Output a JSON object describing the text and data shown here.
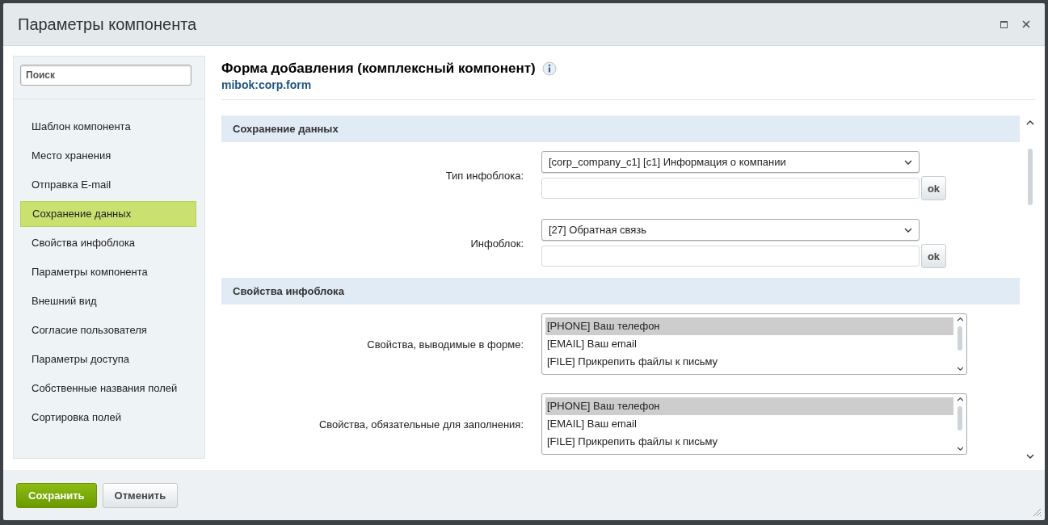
{
  "window": {
    "title": "Параметры компонента"
  },
  "sidebar": {
    "search": {
      "placeholder": "Поиск"
    },
    "items": [
      {
        "label": "Шаблон компонента",
        "selected": false
      },
      {
        "label": "Место хранения",
        "selected": false
      },
      {
        "label": "Отправка E-mail",
        "selected": false
      },
      {
        "label": "Сохранение данных",
        "selected": true
      },
      {
        "label": "Свойства инфоблока",
        "selected": false
      },
      {
        "label": "Параметры компонента",
        "selected": false
      },
      {
        "label": "Внешний вид",
        "selected": false
      },
      {
        "label": "Согласие пользователя",
        "selected": false
      },
      {
        "label": "Параметры доступа",
        "selected": false
      },
      {
        "label": "Собственные названия полей",
        "selected": false
      },
      {
        "label": "Сортировка полей",
        "selected": false
      }
    ]
  },
  "header": {
    "title": "Форма добавления (комплексный компонент)",
    "subtitle": "mibok:corp.form"
  },
  "sections": [
    {
      "title": "Сохранение данных",
      "fields": [
        {
          "kind": "select-with-input",
          "label": "Тип инфоблока:",
          "value": "[corp_company_c1] [c1] Информация о компании",
          "button": "ok"
        },
        {
          "kind": "select-with-input",
          "label": "Инфоблок:",
          "value": "[27] Обратная связь",
          "button": "ok"
        }
      ]
    },
    {
      "title": "Свойства инфоблока",
      "fields": [
        {
          "kind": "listbox",
          "label": "Свойства, выводимые в форме:",
          "options": [
            {
              "label": "[PHONE] Ваш телефон",
              "selected": true
            },
            {
              "label": "[EMAIL] Ваш email",
              "selected": false
            },
            {
              "label": "[FILE] Прикрепить файлы к письму",
              "selected": false
            }
          ]
        },
        {
          "kind": "listbox",
          "label": "Свойства, обязательные для заполнения:",
          "options": [
            {
              "label": "[PHONE] Ваш телефон",
              "selected": true
            },
            {
              "label": "[EMAIL] Ваш email",
              "selected": false
            },
            {
              "label": "[FILE] Прикрепить файлы к письму",
              "selected": false
            }
          ]
        }
      ]
    }
  ],
  "footer": {
    "buttons": [
      {
        "label": "Сохранить",
        "kind": "primary"
      },
      {
        "label": "Отменить",
        "kind": "secondary"
      }
    ]
  }
}
